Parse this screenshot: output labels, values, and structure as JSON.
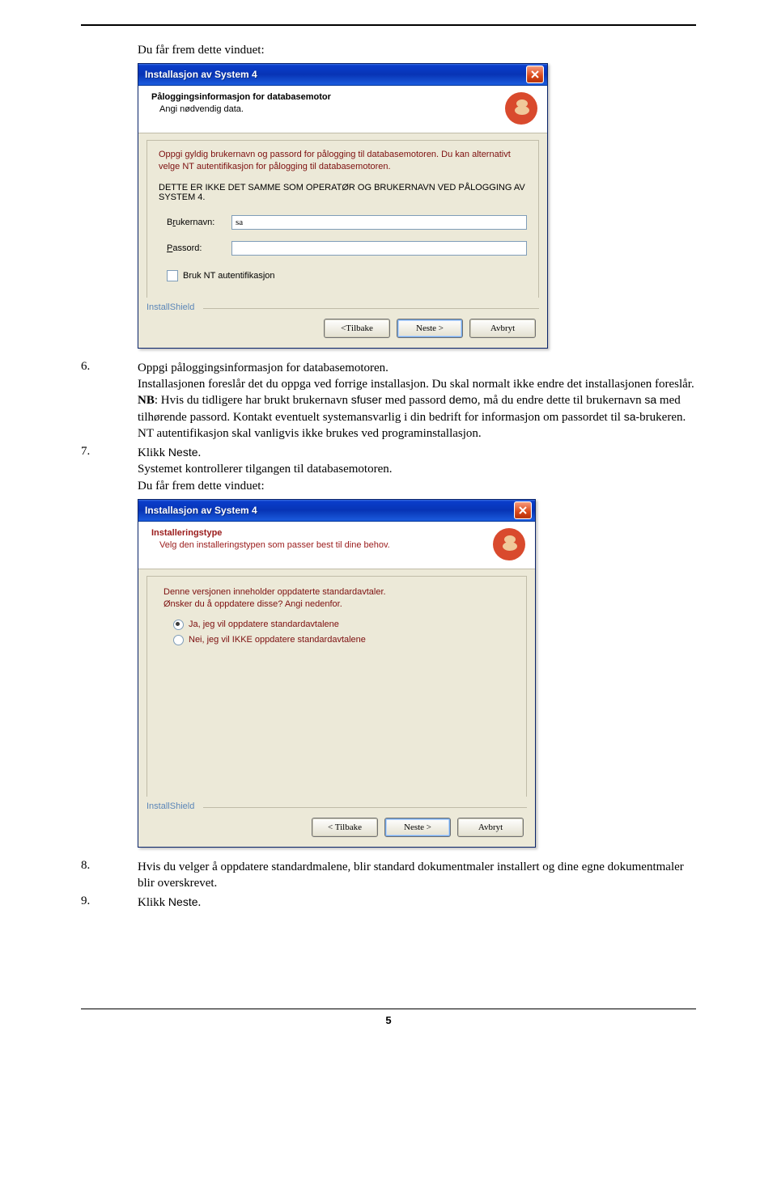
{
  "doc": {
    "intro": "Du får frem dette vinduet:",
    "page_number": "5"
  },
  "steps": {
    "s6": {
      "num": "6.",
      "p1a": "Oppgi påloggingsinformasjon for databasemotoren.",
      "p2": "Installasjonen foreslår det du oppga ved forrige installasjon. Du skal normalt ikke endre det installasjonen foreslår.",
      "p3_prefix": "NB",
      "p3a": ": Hvis du tidligere har brukt brukernavn ",
      "p3_sfuser": "sfuser",
      "p3b": " med passord ",
      "p3_demo": "demo",
      "p3c": ", må du endre dette til brukernavn ",
      "p3_sa": "sa",
      "p3d": " med tilhørende passord. Kontakt eventuelt systemansvarlig i din bedrift for informasjon om passordet til ",
      "p3_sa2": "sa-",
      "p3e": "brukeren.",
      "p4": "NT autentifikasjon skal vanligvis ikke brukes ved programinstallasjon."
    },
    "s7": {
      "num": "7.",
      "p1a": "Klikk ",
      "p1_neste": "Neste",
      "p1b": ".",
      "p2": "Systemet kontrollerer tilgangen til databasemotoren.",
      "p3": "Du får frem dette vinduet:"
    },
    "s8": {
      "num": "8.",
      "p1": "Hvis du velger å oppdatere standardmalene, blir standard dokumentmaler installert og dine egne dokumentmaler blir overskrevet."
    },
    "s9": {
      "num": "9.",
      "p1a": "Klikk ",
      "p1_neste": "Neste",
      "p1b": "."
    }
  },
  "dialog1": {
    "title": "Installasjon av System 4",
    "header_title": "Påloggingsinformasjon for databasemotor",
    "header_sub": "Angi nødvendig data.",
    "intro_line1": "Oppgi gyldig brukernavn og passord for pålogging til databasemotoren. Du kan alternativt velge NT autentifikasjon for pålogging til databasemotoren.",
    "caps": "DETTE ER IKKE DET SAMME SOM OPERATØR OG BRUKERNAVN VED PÅLOGGING AV SYSTEM 4.",
    "label_user_pre": "B",
    "label_user_u": "r",
    "label_user_post": "ukernavn:",
    "user_value": "sa",
    "label_pass_u": "P",
    "label_pass_post": "assord:",
    "pass_value": "",
    "chk_u": "B",
    "chk_post": "ruk NT autentifikasjon",
    "installshield": "InstallShield",
    "btn_back_pre": "< ",
    "btn_back_u": "T",
    "btn_back_post": "ilbake",
    "btn_next_u": "N",
    "btn_next_post": "este >",
    "btn_cancel": "Avbryt"
  },
  "dialog2": {
    "title": "Installasjon av System 4",
    "header_title": "Installeringstype",
    "header_sub": "Velg den installeringstypen som passer best til dine behov.",
    "info_l1": "Denne versjonen inneholder oppdaterte standardavtaler.",
    "info_l2": "Ønsker du å oppdatere disse? Angi nedenfor.",
    "opt1": "Ja, jeg vil oppdatere standardavtalene",
    "opt2": "Nei, jeg vil IKKE oppdatere standardavtalene",
    "installshield": "InstallShield",
    "btn_back": "< Tilbake",
    "btn_next": "Neste >",
    "btn_cancel": "Avbryt"
  }
}
